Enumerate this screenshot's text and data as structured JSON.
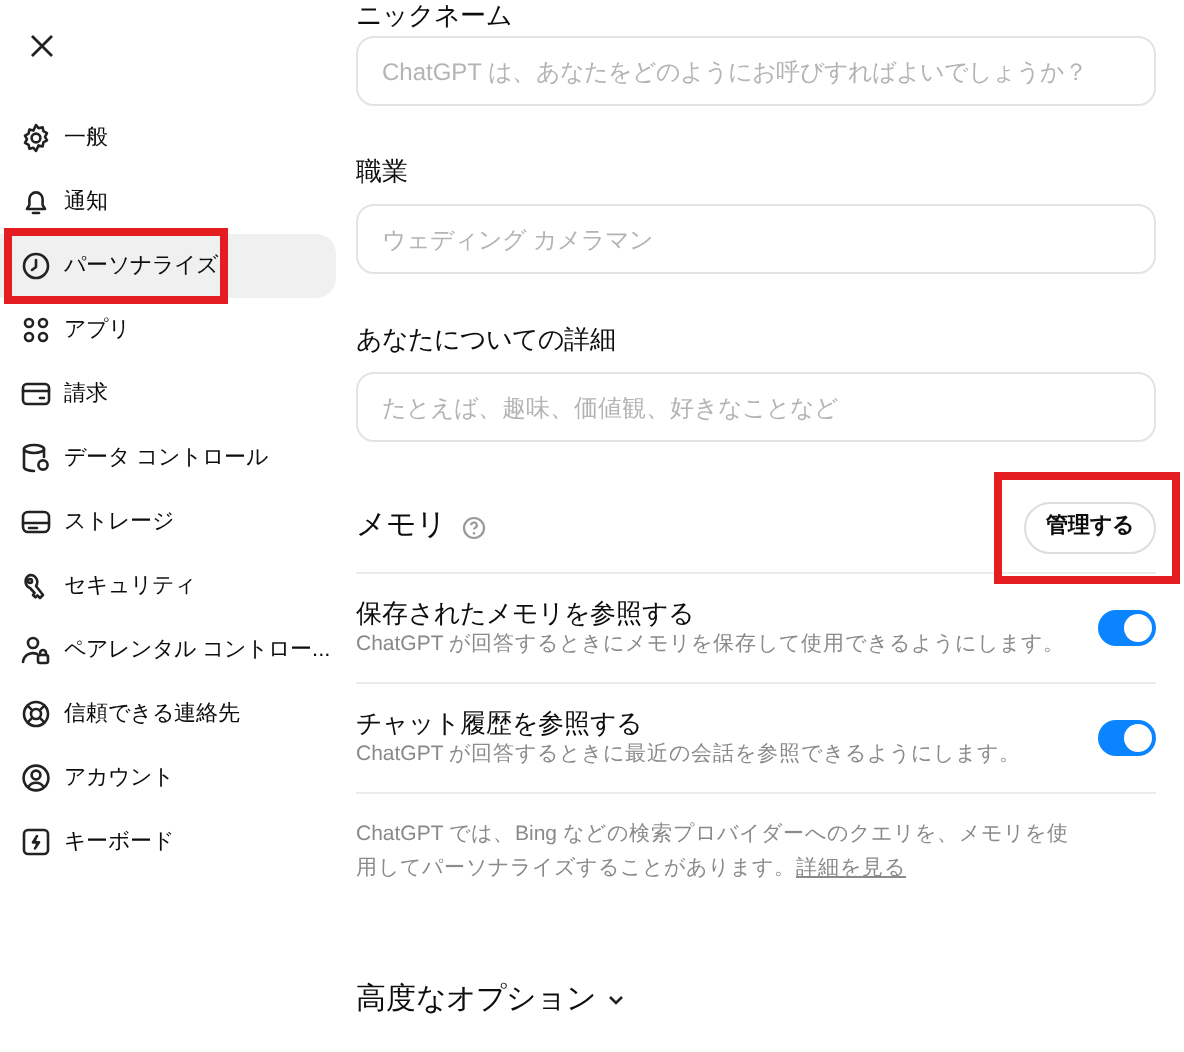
{
  "sidebar": {
    "items": [
      {
        "kind": "gear",
        "label": "一般",
        "selected": false,
        "highlighted": false
      },
      {
        "kind": "bell",
        "label": "通知",
        "selected": false,
        "highlighted": false
      },
      {
        "kind": "persona",
        "label": "パーソナライズ",
        "selected": true,
        "highlighted": true
      },
      {
        "kind": "apps",
        "label": "アプリ",
        "selected": false,
        "highlighted": false
      },
      {
        "kind": "card",
        "label": "請求",
        "selected": false,
        "highlighted": false
      },
      {
        "kind": "data",
        "label": "データ コントロール",
        "selected": false,
        "highlighted": false
      },
      {
        "kind": "storage",
        "label": "ストレージ",
        "selected": false,
        "highlighted": false
      },
      {
        "kind": "security",
        "label": "セキュリティ",
        "selected": false,
        "highlighted": false
      },
      {
        "kind": "parent",
        "label": "ペアレンタル コントロー...",
        "selected": false,
        "highlighted": false
      },
      {
        "kind": "lifebuoy",
        "label": "信頼できる連絡先",
        "selected": false,
        "highlighted": false
      },
      {
        "kind": "account",
        "label": "アカウント",
        "selected": false,
        "highlighted": false
      },
      {
        "kind": "keyboard",
        "label": "キーボード",
        "selected": false,
        "highlighted": false
      }
    ]
  },
  "fields": [
    {
      "label": "ニックネーム",
      "placeholder": "ChatGPT は、あなたをどのようにお呼びすればよいでしょうか？"
    },
    {
      "label": "職業",
      "placeholder": "ウェディング カメラマン"
    },
    {
      "label": "あなたについての詳細",
      "placeholder": "たとえば、趣味、価値観、好きなことなど"
    }
  ],
  "memory": {
    "title": "メモリ",
    "manage_button": {
      "label": "管理する",
      "highlighted": true
    },
    "toggles": [
      {
        "title": "保存されたメモリを参照する",
        "description": "ChatGPT が回答するときにメモリを保存して使用できるようにします。",
        "on": true
      },
      {
        "title": "チャット履歴を参照する",
        "description": "ChatGPT が回答するときに最近の会話を参照できるようにします。",
        "on": true
      }
    ],
    "note": "ChatGPT では、Bing などの検索プロバイダーへのクエリを、メモリを使用してパーソナライズすることがあります。",
    "note_link": "詳細を見る"
  },
  "advanced": {
    "label": "高度なオプション"
  }
}
